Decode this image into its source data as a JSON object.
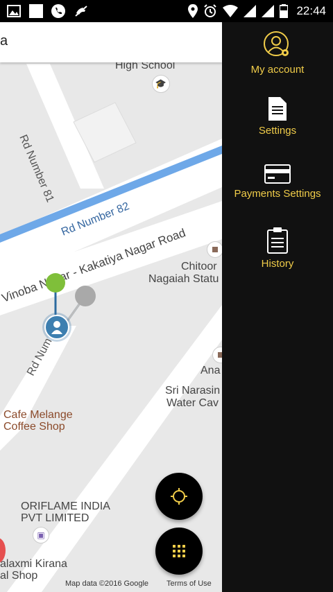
{
  "status_bar": {
    "time": "22:44",
    "left_icons": [
      "image-icon",
      "square-icon",
      "phone-call-icon",
      "missed-call-icon"
    ],
    "right_icons": [
      "location-icon",
      "alarm-icon",
      "wifi-icon",
      "signal-icon",
      "signal-icon",
      "battery-icon"
    ]
  },
  "search": {
    "text": "a"
  },
  "map": {
    "labels": {
      "high_school": "High School",
      "rd81": "Rd Number 81",
      "rd82": "Rd Number 82",
      "kakatiya": "Vinoba Nagar - Kakatiya Nagar Road",
      "rd_num_short": "Rd Num",
      "chitoor1": "Chitoor",
      "chitoor2": "Nagaiah Statu",
      "ana": "Ana",
      "sri1": "Sri Narasin",
      "sri2": "Water Cav",
      "cafe1": "Cafe Melange",
      "cafe2": "Coffee Shop",
      "ori1": "ORIFLAME INDIA",
      "ori2": "PVT LIMITED",
      "lax1": "alaxmi Kirana",
      "lax2": "al Shop"
    },
    "footer": {
      "map_data": "Map data ©2016 Google",
      "terms": "Terms of Use"
    },
    "fabs": [
      {
        "name": "locate-button",
        "icon": "crosshair-icon"
      },
      {
        "name": "menu-grid-button",
        "icon": "grid-dots-icon"
      }
    ]
  },
  "drawer": {
    "accent": "#f0cc49",
    "items": [
      {
        "label": "My account",
        "icon": "account-settings-icon"
      },
      {
        "label": "Settings",
        "icon": "document-icon"
      },
      {
        "label": "Payments Settings",
        "icon": "credit-card-icon"
      },
      {
        "label": "History",
        "icon": "clipboard-icon"
      }
    ]
  }
}
